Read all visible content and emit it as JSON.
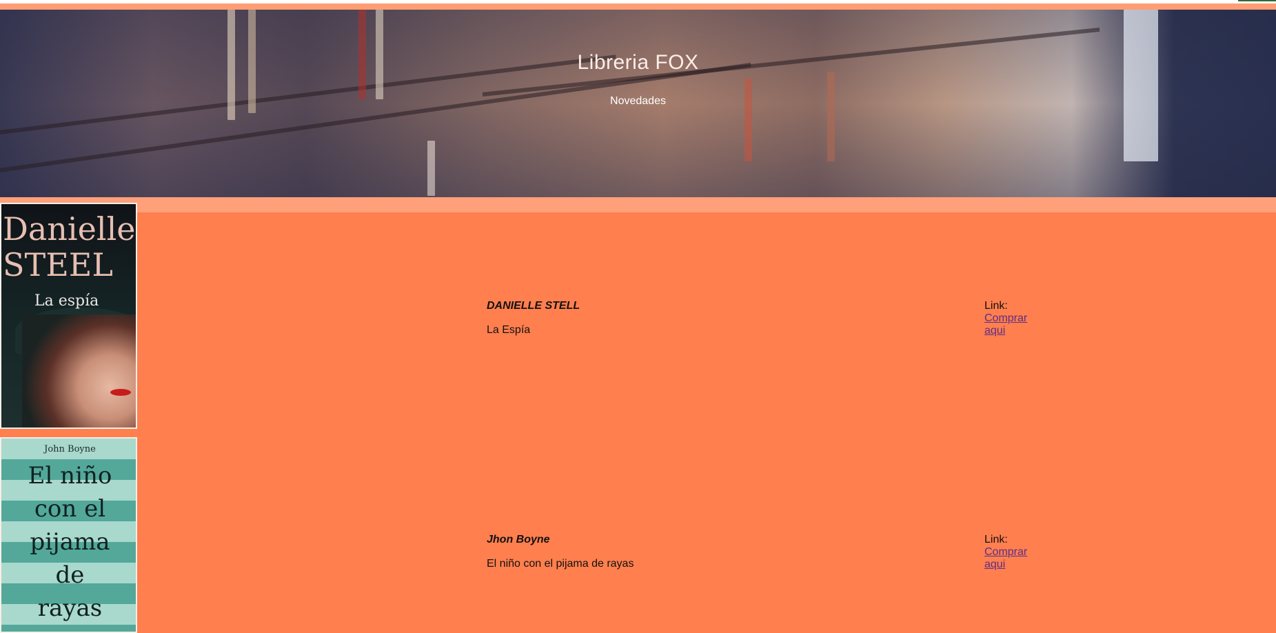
{
  "header": {
    "title": "Libreria FOX",
    "subtitle": "Novedades"
  },
  "books": [
    {
      "author": "DANIELLE STELL",
      "title": "La Espía",
      "link_label": "Link:",
      "link_text": "Comprar aqui",
      "cover": {
        "author_text": "Danielle\nSTEEL",
        "title_text": "La espía"
      }
    },
    {
      "author": "Jhon Boyne",
      "title": "El niño con el pijama de rayas",
      "link_label": "Link:",
      "link_text": "Comprar aqui",
      "cover": {
        "author_text": "John Boyne",
        "title_text": "El niño\ncon el\npijama\nde\nrayas"
      }
    }
  ],
  "colors": {
    "background": "#ff7f4e",
    "band": "#ffa07a",
    "link": "#5b2d86"
  }
}
